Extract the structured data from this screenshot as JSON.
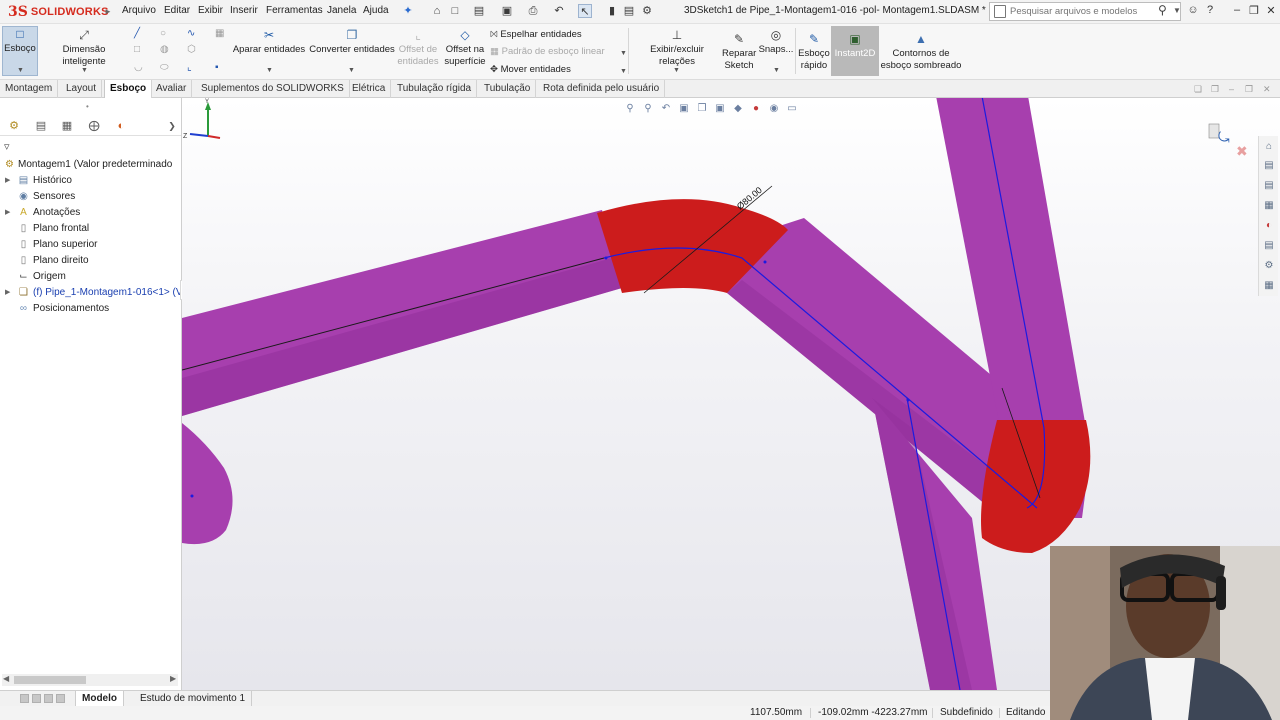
{
  "app": {
    "logo_prefix": "3S",
    "logo_text": "SOLIDWORKS",
    "document_title": "3DSketch1 de Pipe_1-Montagem1-016 -pol- Montagem1.SLDASM *"
  },
  "menu": [
    "Arquivo",
    "Editar",
    "Exibir",
    "Inserir",
    "Ferramentas",
    "Janela",
    "Ajuda"
  ],
  "search": {
    "placeholder": "Pesquisar arquivos e modelos"
  },
  "commands": {
    "sketch": "Esboço",
    "smart_dimension": "Dimensão inteligente",
    "trim": "Aparar entidades",
    "convert": "Converter entidades",
    "offset_entities_1": "Offset de",
    "offset_entities_2": "entidades",
    "offset_surface_1": "Offset na",
    "offset_surface_2": "superfície",
    "mirror": "Espelhar entidades",
    "linear_pattern": "Padrão de esboço linear",
    "move": "Mover entidades",
    "display_relations": "Exibir/excluir relações",
    "repair_1": "Reparar",
    "repair_2": "Sketch",
    "snaps": "Snaps...",
    "rapid_sketch_1": "Esboço",
    "rapid_sketch_2": "rápido",
    "instant2d": "Instant2D",
    "shaded_1": "Contornos de",
    "shaded_2": "esboço sombreado"
  },
  "tabs": [
    "Montagem",
    "Layout",
    "Esboço",
    "Avaliar",
    "Suplementos do SOLIDWORKS",
    "Elétrica",
    "Tubulação rígida",
    "Tubulação",
    "Rota definida pelo usuário"
  ],
  "active_tab": "Esboço",
  "tree": {
    "root": "Montagem1  (Valor predeterminado",
    "items": [
      "Histórico",
      "Sensores",
      "Anotações",
      "Plano frontal",
      "Plano superior",
      "Plano direito",
      "Origem",
      "(f) Pipe_1-Montagem1-016<1> (V",
      "Posicionamentos"
    ]
  },
  "viewport": {
    "dimension_label": "Ø80.00"
  },
  "bottom_tabs": [
    "Modelo",
    "Estudo de movimento 1"
  ],
  "status": {
    "x": "1107.50mm",
    "yz": "-109.02mm -4223.27mm",
    "state": "Subdefinido",
    "mode": "Editando"
  },
  "colors": {
    "pipe": "#a73fae",
    "pipe_dark": "#8f2e97",
    "elbow": "#cc1c1c",
    "sketch_line": "#1b1be0",
    "brand": "#d52b1e"
  }
}
